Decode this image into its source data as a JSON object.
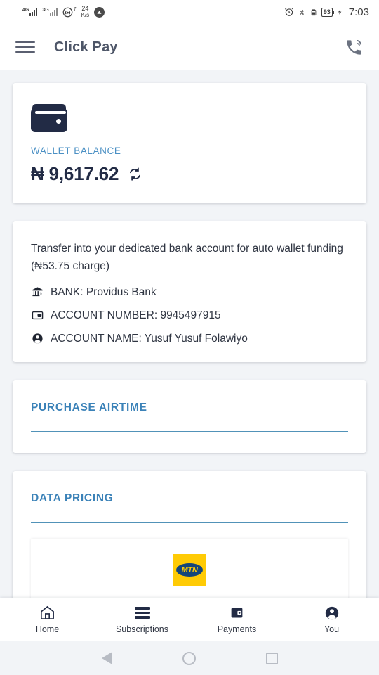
{
  "status_bar": {
    "network_primary": "4G",
    "network_secondary": "3G",
    "hotspot_count": "7",
    "data_rate_value": "24",
    "data_rate_unit": "K/s",
    "battery_percent": "93",
    "time": "7:03"
  },
  "app_bar": {
    "title": "Click Pay",
    "menu_icon": "hamburger-menu-icon",
    "call_icon": "phone-ringing-icon"
  },
  "wallet_card": {
    "icon": "wallet-icon",
    "label": "WALLET BALANCE",
    "amount": "₦ 9,617.62",
    "refresh_icon": "refresh-icon"
  },
  "transfer_card": {
    "description": "Transfer into your dedicated bank account for auto wallet funding (₦53.75 charge)",
    "rows": [
      {
        "icon": "bank-icon",
        "text": "BANK: Providus Bank"
      },
      {
        "icon": "card-icon",
        "text": "ACCOUNT NUMBER: 9945497915"
      },
      {
        "icon": "person-icon",
        "text": "ACCOUNT NAME: Yusuf Yusuf Folawiyo"
      }
    ]
  },
  "airtime_section": {
    "title": "PURCHASE AIRTIME"
  },
  "data_section": {
    "title": "DATA PRICING",
    "network_logo_label": "MTN"
  },
  "bottom_nav": {
    "items": [
      {
        "label": "Home",
        "icon": "home-icon"
      },
      {
        "label": "Subscriptions",
        "icon": "list-bars-icon"
      },
      {
        "label": "Payments",
        "icon": "wallet-icon"
      },
      {
        "label": "You",
        "icon": "person-circle-icon"
      }
    ]
  },
  "system_nav": {
    "back": "back-triangle-icon",
    "home": "home-circle-icon",
    "recents": "recents-square-icon"
  },
  "colors": {
    "accent_blue": "#3b82b8",
    "wallet_label_blue": "#4b90c4",
    "dark_navy": "#222b45",
    "mtn_yellow": "#ffcb05",
    "mtn_blue": "#15467a",
    "page_bg": "#f2f4f7"
  }
}
